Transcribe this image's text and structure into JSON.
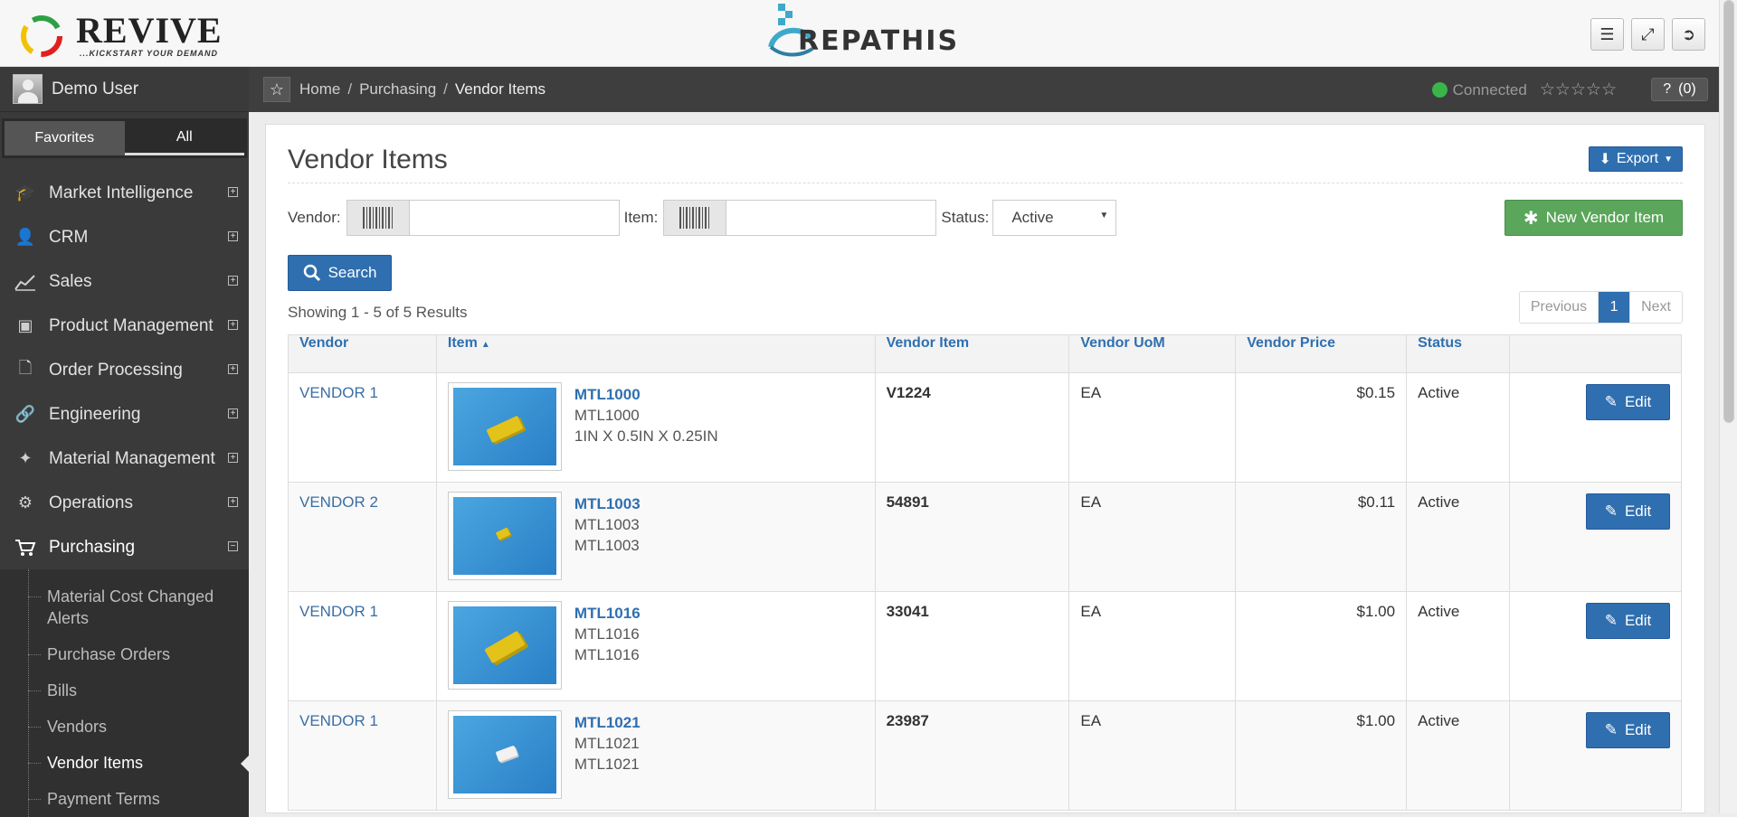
{
  "brand": {
    "name": "REVIVE",
    "tagline": "...KICKSTART YOUR DEMAND",
    "app_logo_text": "REPATHIS"
  },
  "top_buttons": [
    "menu-icon",
    "fullscreen-icon",
    "logout-icon"
  ],
  "sidebar": {
    "user_name": "Demo User",
    "tabs": [
      {
        "label": "Favorites"
      },
      {
        "label": "All"
      }
    ],
    "items": [
      {
        "label": "Market Intelligence",
        "icon": "graduation-cap-icon"
      },
      {
        "label": "CRM",
        "icon": "user-icon"
      },
      {
        "label": "Sales",
        "icon": "line-chart-icon"
      },
      {
        "label": "Product Management",
        "icon": "cube-icon"
      },
      {
        "label": "Order Processing",
        "icon": "files-icon"
      },
      {
        "label": "Engineering",
        "icon": "link-icon"
      },
      {
        "label": "Material Management",
        "icon": "puzzle-icon"
      },
      {
        "label": "Operations",
        "icon": "gears-icon"
      },
      {
        "label": "Purchasing",
        "icon": "cart-icon"
      }
    ],
    "sub_items": [
      {
        "label": "Material Cost Changed Alerts"
      },
      {
        "label": "Purchase Orders"
      },
      {
        "label": "Bills"
      },
      {
        "label": "Vendors"
      },
      {
        "label": "Vendor Items"
      },
      {
        "label": "Payment Terms"
      }
    ]
  },
  "breadcrumb": {
    "items": [
      "Home",
      "Purchasing",
      "Vendor Items"
    ],
    "separator": "/",
    "status": "Connected",
    "help_count": "(0)"
  },
  "page": {
    "title": "Vendor Items",
    "export_label": "Export",
    "filters": {
      "vendor_label": "Vendor:",
      "item_label": "Item:",
      "status_label": "Status:",
      "status_value": "Active"
    },
    "new_button": "New Vendor Item",
    "search_button": "Search",
    "showing": "Showing 1 - 5 of 5 Results",
    "pager": {
      "previous": "Previous",
      "page": "1",
      "next": "Next"
    }
  },
  "table": {
    "columns": [
      "Vendor",
      "Item",
      "Vendor Item",
      "Vendor UoM",
      "Vendor Price",
      "Status",
      ""
    ],
    "rows": [
      {
        "vendor": "VENDOR 1",
        "item_code": "MTL1000",
        "item_line2": "MTL1000",
        "item_line3": "1IN X 0.5IN X 0.25IN",
        "vendor_item": "V1224",
        "uom": "EA",
        "price": "$0.15",
        "status": "Active",
        "edit": "Edit"
      },
      {
        "vendor": "VENDOR 2",
        "item_code": "MTL1003",
        "item_line2": "MTL1003",
        "item_line3": "MTL1003",
        "vendor_item": "54891",
        "uom": "EA",
        "price": "$0.11",
        "status": "Active",
        "edit": "Edit"
      },
      {
        "vendor": "VENDOR 1",
        "item_code": "MTL1016",
        "item_line2": "MTL1016",
        "item_line3": "MTL1016",
        "vendor_item": "33041",
        "uom": "EA",
        "price": "$1.00",
        "status": "Active",
        "edit": "Edit"
      },
      {
        "vendor": "VENDOR 1",
        "item_code": "MTL1021",
        "item_line2": "MTL1021",
        "item_line3": "MTL1021",
        "vendor_item": "23987",
        "uom": "EA",
        "price": "$1.00",
        "status": "Active",
        "edit": "Edit"
      }
    ]
  },
  "colors": {
    "accent_blue": "#2f6fb0",
    "success_green": "#5aa65a",
    "sidebar_bg": "#3a3a3a",
    "connected_dot": "#3ab54a"
  }
}
